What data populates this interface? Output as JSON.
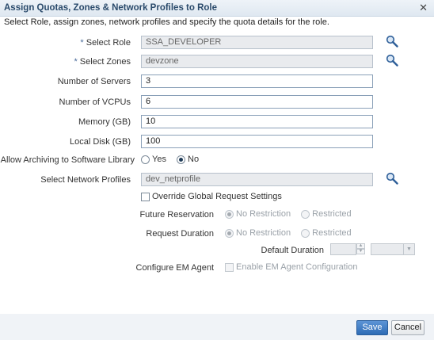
{
  "dialog": {
    "title": "Assign Quotas, Zones & Network Profiles to Role",
    "close_glyph": "✕",
    "instructions": "Select Role, assign zones, network profiles and specify the quota details for the role."
  },
  "form": {
    "required_marker": "*",
    "select_role": {
      "label": "Select Role",
      "value": "SSA_DEVELOPER"
    },
    "select_zones": {
      "label": "Select Zones",
      "value": "devzone"
    },
    "number_of_servers": {
      "label": "Number of Servers",
      "value": "3"
    },
    "number_of_vcpus": {
      "label": "Number of VCPUs",
      "value": "6"
    },
    "memory": {
      "label": "Memory (GB)",
      "value": "10"
    },
    "local_disk": {
      "label": "Local Disk (GB)",
      "value": "100"
    },
    "allow_archiving": {
      "label": "Allow Archiving to Software Library",
      "options": [
        "Yes",
        "No"
      ],
      "selected": "No"
    },
    "network_profiles": {
      "label": "Select Network Profiles",
      "value": "dev_netprofile"
    },
    "override_global": {
      "label": "Override Global Request Settings",
      "checked": false
    },
    "future_reservation": {
      "label": "Future Reservation",
      "options": [
        "No Restriction",
        "Restricted"
      ],
      "selected": "No Restriction"
    },
    "request_duration": {
      "label": "Request Duration",
      "options": [
        "No Restriction",
        "Restricted"
      ],
      "selected": "No Restriction"
    },
    "default_duration": {
      "label": "Default Duration",
      "value": "",
      "unit": ""
    },
    "configure_em_agent": {
      "label": "Configure EM Agent",
      "checkbox_label": "Enable EM Agent Configuration",
      "checked": false
    }
  },
  "footer": {
    "save_label": "Save",
    "cancel_label": "Cancel"
  },
  "icons": {
    "search": "search-icon"
  },
  "colors": {
    "save_button": "#2f6cb5",
    "title_text": "#2a4a6b",
    "required_marker": "#4a6c9b"
  }
}
